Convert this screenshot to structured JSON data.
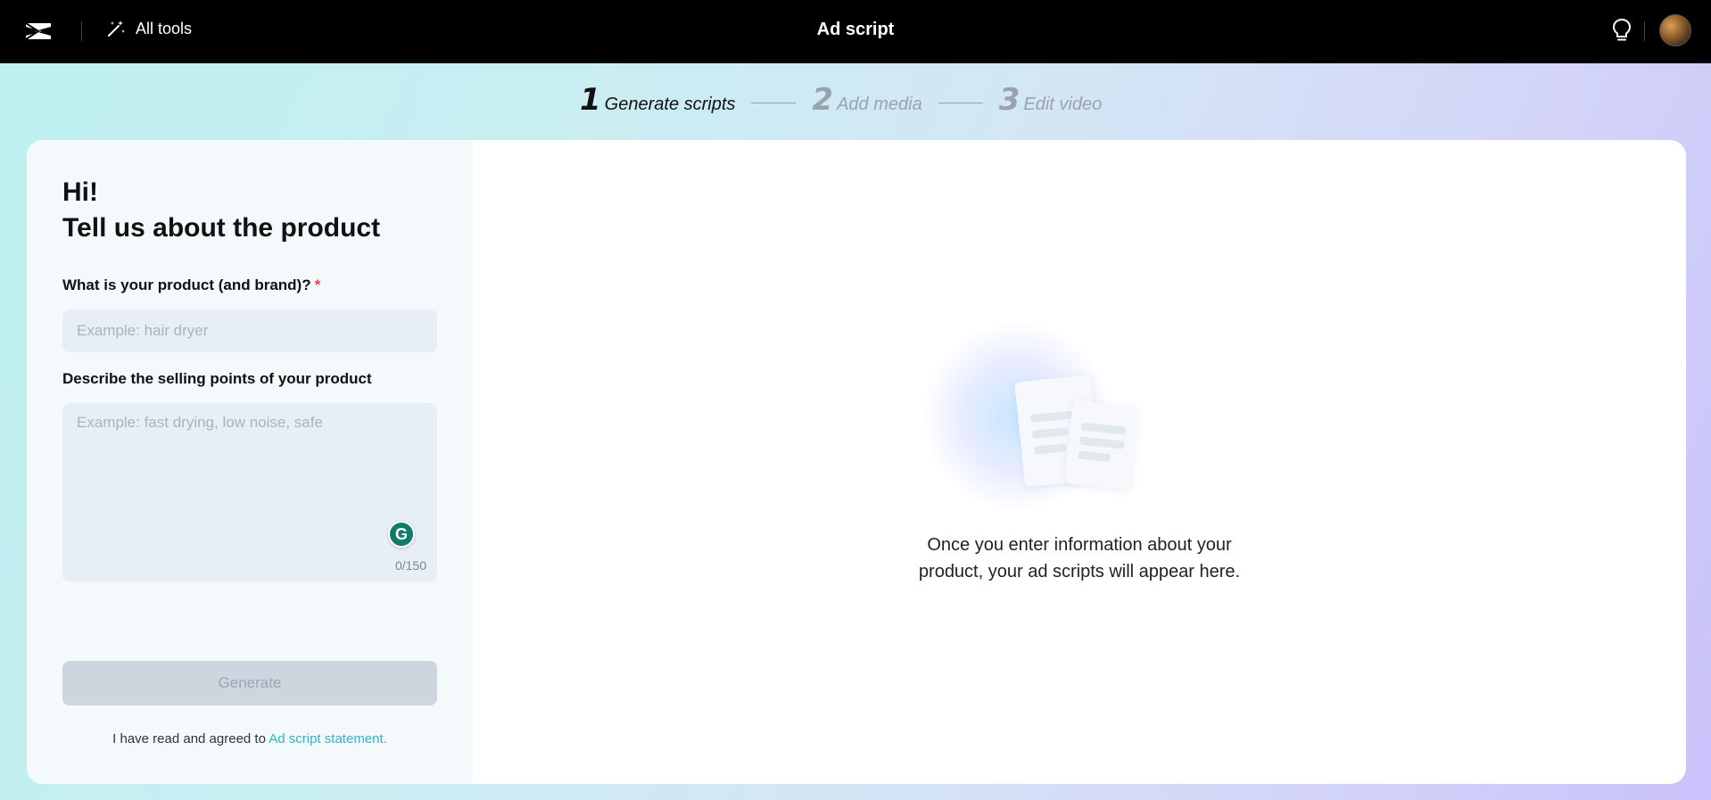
{
  "header": {
    "all_tools_label": "All tools",
    "page_title": "Ad script"
  },
  "stepper": [
    {
      "num": "1",
      "label": "Generate scripts",
      "state": "active"
    },
    {
      "num": "2",
      "label": "Add media",
      "state": "inactive"
    },
    {
      "num": "3",
      "label": "Edit video",
      "state": "inactive"
    }
  ],
  "form": {
    "greeting_line1": "Hi!",
    "greeting_line2": "Tell us about the product",
    "product_label": "What is your product (and brand)?",
    "required_mark": "*",
    "product_placeholder": "Example: hair dryer",
    "product_value": "",
    "selling_points_label": "Describe the selling points of your product",
    "selling_points_placeholder": "Example: fast drying, low noise, safe",
    "selling_points_value": "",
    "char_counter": "0/150",
    "grammarly_letter": "G",
    "generate_label": "Generate",
    "agree_text": "I have read and agreed to ",
    "agree_link": "Ad script statement."
  },
  "empty_state": {
    "line1": "Once you enter information about your",
    "line2": "product, your ad scripts will appear here."
  },
  "colors": {
    "topbar": "#000000",
    "link": "#2eb3c9",
    "required": "#e5484d",
    "grammarly": "#0e7c6b",
    "button_disabled": "#cdd6df"
  },
  "icons": [
    "capcut-logo-icon",
    "magic-wand-icon",
    "lightbulb-icon",
    "avatar",
    "document-icon"
  ]
}
